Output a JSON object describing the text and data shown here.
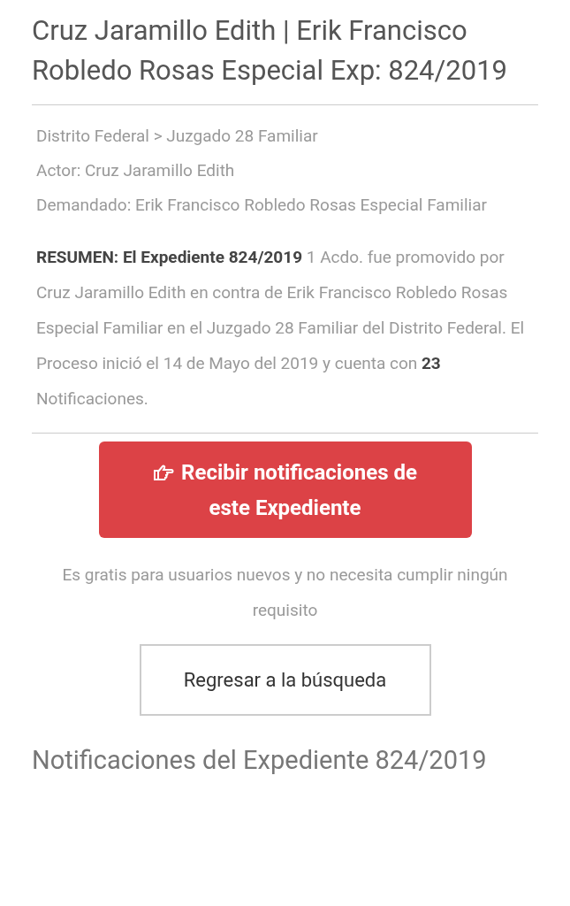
{
  "title": "Cruz Jaramillo Edith | Erik Francisco Robledo Rosas Especial Exp: 824/2019",
  "details": [
    "Distrito Federal > Juzgado 28 Familiar",
    "Actor: Cruz Jaramillo Edith",
    "Demandado: Erik Francisco Robledo Rosas Especial Familiar"
  ],
  "summary": "**RESUMEN: El Expediente 824/2019** 1 Acdo. fue promovido por Cruz Jaramillo Edith en contra de Erik Francisco Robledo Rosas Especial Familiar en el Juzgado 28 Familiar del Distrito Federal. El Proceso inició el 14 de Mayo del 2019 y cuenta con **23** Notificaciones.",
  "subscribe_button": "Recibir notificaciones de este Expediente",
  "note": "Es gratis para usuarios nuevos y no necesita cumplir ningún requisito",
  "back_button": "Regresar a la búsqueda",
  "section_heading": "Notificaciones del Expediente 824/2019"
}
